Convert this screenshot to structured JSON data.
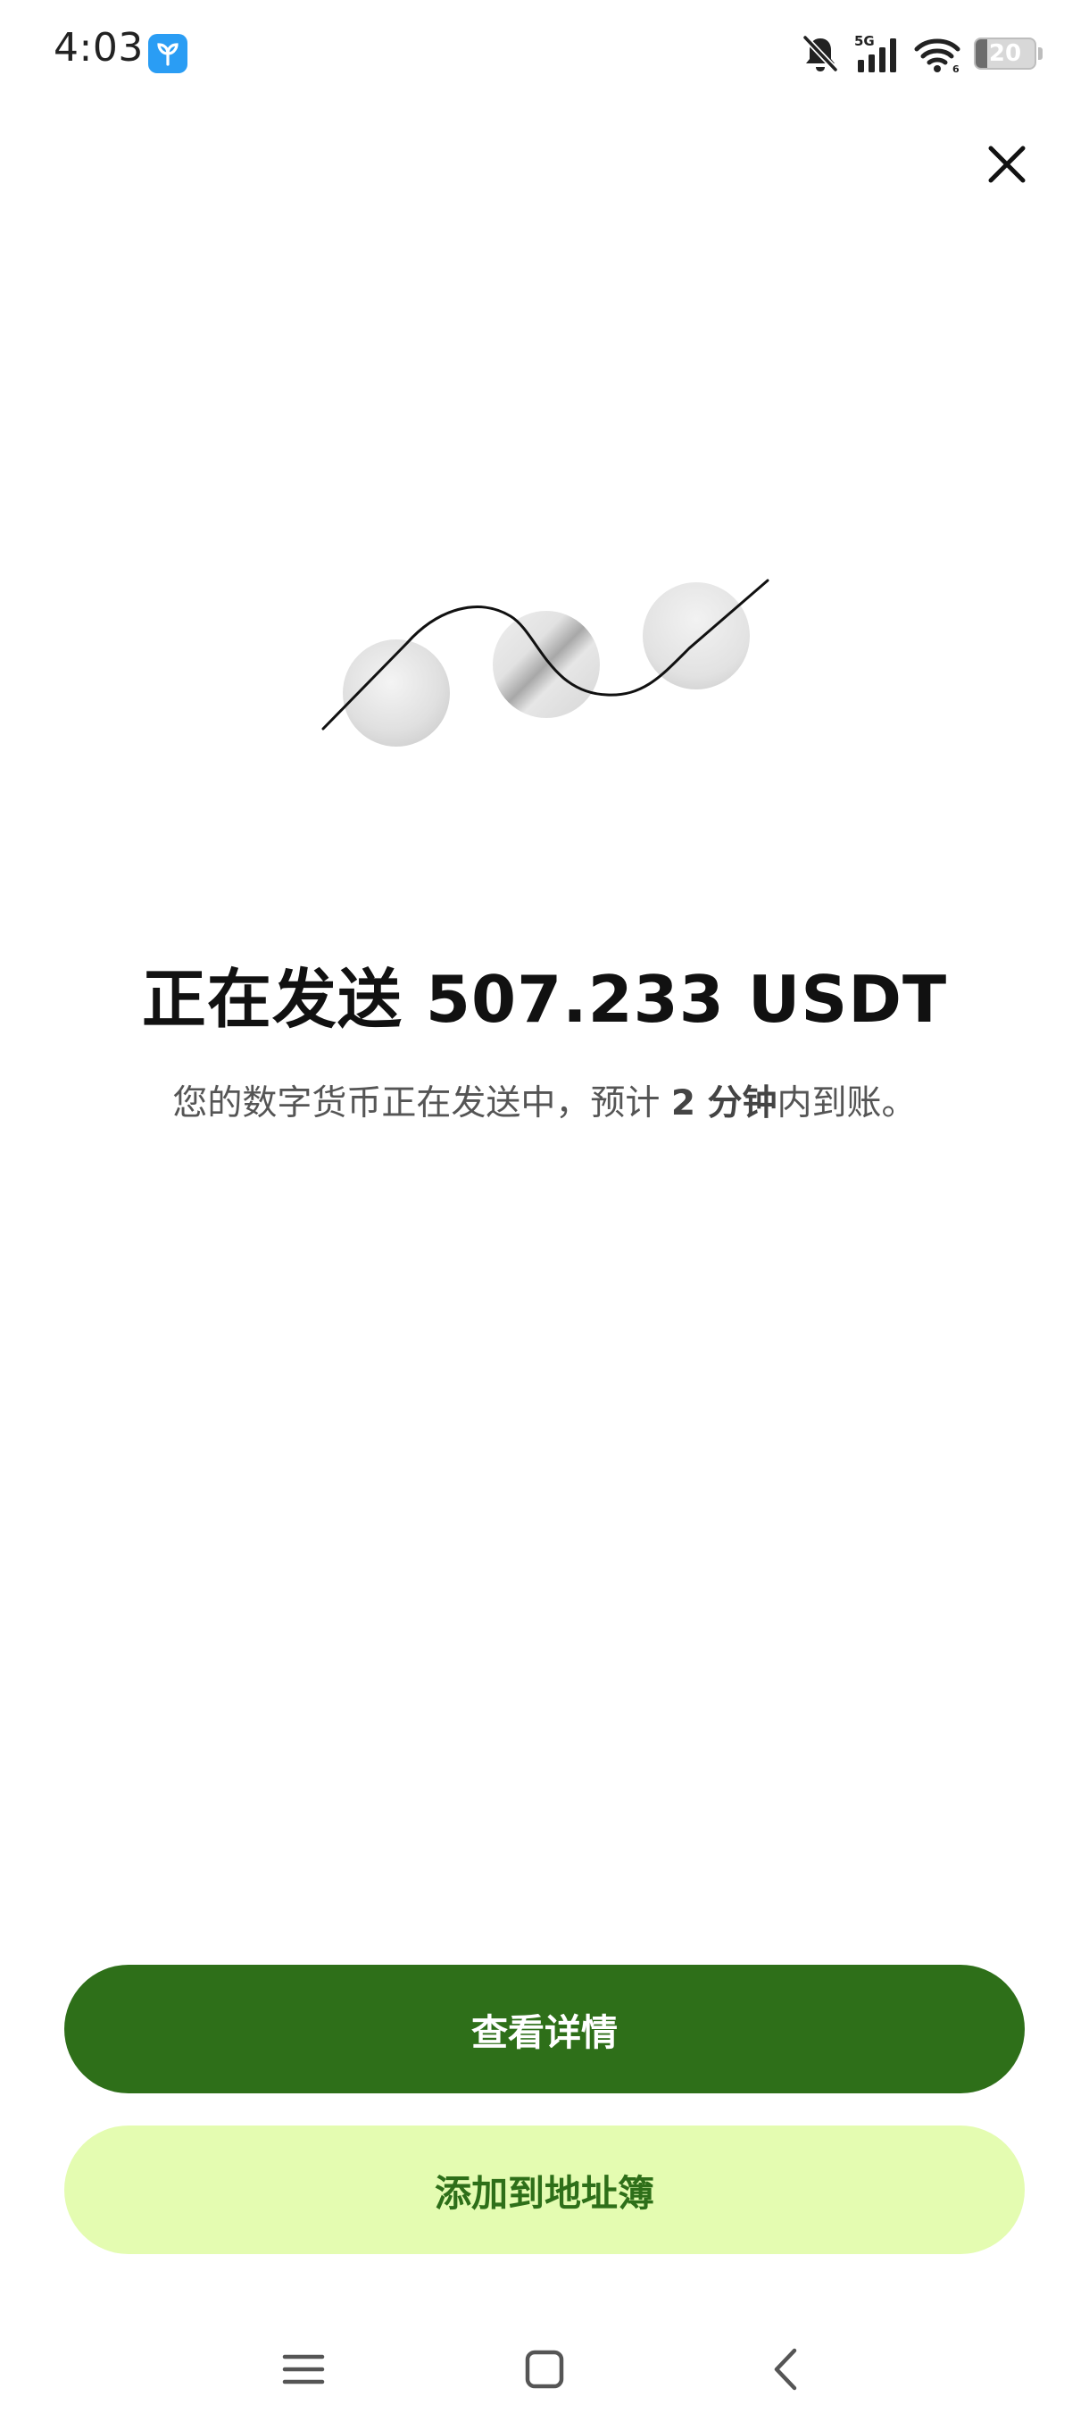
{
  "status_bar": {
    "time": "4:03",
    "network_label": "5G",
    "battery_level": 20,
    "battery_label": "20",
    "icons": [
      "app-notification-icon",
      "bell-muted-icon",
      "signal-icon",
      "wifi-icon",
      "battery-icon"
    ]
  },
  "header": {
    "close_icon": "close-icon"
  },
  "main": {
    "title": "正在发送 507.233 USDT",
    "subtitle_prefix": "您的数字货币正在发送中，预计 ",
    "subtitle_eta": "2 分钟",
    "subtitle_suffix": "内到账。"
  },
  "actions": {
    "view_details_label": "查看详情",
    "add_to_address_book_label": "添加到地址簿"
  },
  "nav_bar": {
    "icons": [
      "menu-icon",
      "home-icon",
      "back-icon"
    ]
  },
  "colors": {
    "primary_green": "#2e6f19",
    "light_green": "#e4fcb1",
    "text_dark": "#111111",
    "text_muted": "#555555"
  }
}
